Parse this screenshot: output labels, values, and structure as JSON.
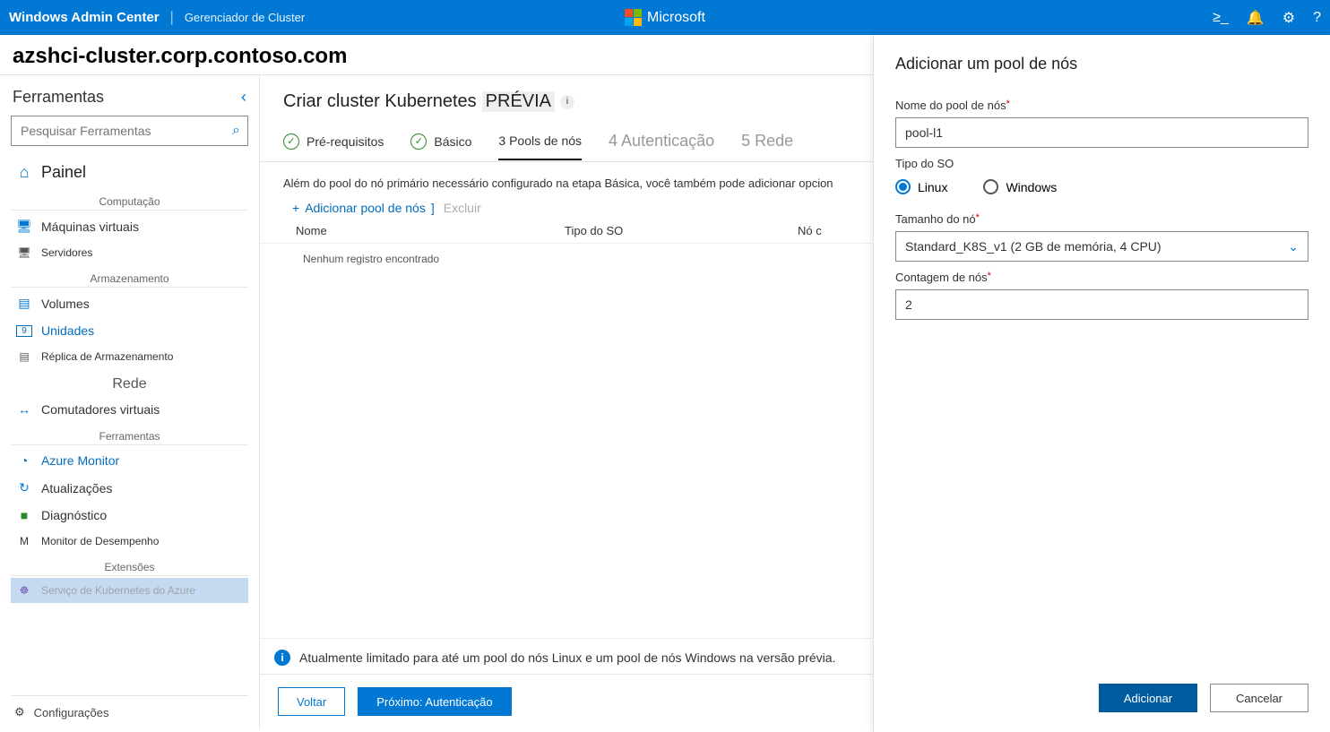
{
  "topbar": {
    "product": "Windows Admin Center",
    "context": "Gerenciador de Cluster",
    "brand": "Microsoft"
  },
  "breadcrumb": "azshci-cluster.corp.contoso.com",
  "sidebar": {
    "title": "Ferramentas",
    "search_placeholder": "Pesquisar Ferramentas",
    "dashboard": "Painel",
    "groups": {
      "compute": "Computação",
      "storage": "Armazenamento",
      "network": "Rede",
      "tools": "Ferramentas",
      "extensions": "Extensões"
    },
    "items": {
      "vms": "Máquinas virtuais",
      "servers": "Servidores",
      "volumes": "Volumes",
      "drives": "Unidades",
      "drives_count": "9",
      "storage_replica": "Réplica de Armazenamento",
      "vswitches": "Comutadores virtuais",
      "azure_monitor": "Azure Monitor",
      "updates": "Atualizações",
      "diagnostics": "Diagnóstico",
      "perf_monitor": "Monitor de Desempenho",
      "aks": "Serviço de Kubernetes do Azure"
    },
    "settings": "Configurações"
  },
  "main": {
    "title_a": "Criar cluster Kubernetes",
    "title_b": "PRÉVIA",
    "steps": {
      "s1": "Pré-requisitos",
      "s2": "Básico",
      "s3": "3 Pools de nós",
      "s4": "4 Autenticação",
      "s5": "5 Rede"
    },
    "intro": "Além do pool do nó primário necessário configurado na etapa Básica, você também pode adicionar opcion",
    "toolbar": {
      "add": "Adicionar pool de nós",
      "bracket": "]",
      "del": "Excluir"
    },
    "table": {
      "col_name": "Nome",
      "col_os": "Tipo do SO",
      "col_count": "Nó c",
      "empty": "Nenhum registro encontrado"
    },
    "banner": "Atualmente limitado para até um pool do nós Linux e um pool de nós Windows na versão prévia.",
    "back": "Voltar",
    "next": "Próximo: Autenticação"
  },
  "flyout": {
    "title": "Adicionar um pool de nós",
    "name_label": "Nome do pool de nós",
    "name_value": "pool-l1",
    "os_label": "Tipo do SO",
    "os_linux": "Linux",
    "os_windows": "Windows",
    "size_label": "Tamanho do nó",
    "size_value": "Standard_K8S_v1 (2 GB de memória, 4 CPU)",
    "count_label": "Contagem de nós",
    "count_value": "2",
    "add": "Adicionar",
    "cancel": "Cancelar"
  }
}
